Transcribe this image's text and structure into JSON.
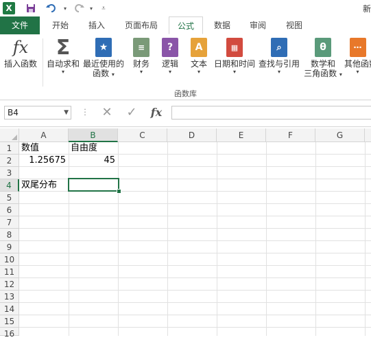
{
  "title_fragment": "新",
  "quick_access": {
    "excel_logo": "X",
    "save_icon": "save-icon",
    "undo_icon": "undo-icon",
    "redo_icon": "redo-icon"
  },
  "tabs": [
    {
      "label": "文件"
    },
    {
      "label": "开始"
    },
    {
      "label": "插入"
    },
    {
      "label": "页面布局"
    },
    {
      "label": "公式"
    },
    {
      "label": "数据"
    },
    {
      "label": "审阅"
    },
    {
      "label": "视图"
    }
  ],
  "active_tab": "公式",
  "ribbon": {
    "insert_function": {
      "label": "插入函数",
      "glyph": "fx"
    },
    "autosum": {
      "label": "自动求和",
      "glyph": "Σ"
    },
    "recent": {
      "line1": "最近使用的",
      "line2": "函数"
    },
    "financial": {
      "label": "财务"
    },
    "logical": {
      "label": "逻辑",
      "glyph": "?"
    },
    "text": {
      "label": "文本",
      "glyph": "A"
    },
    "datetime": {
      "label": "日期和时间"
    },
    "lookup": {
      "label": "查找与引用"
    },
    "math": {
      "line1": "数学和",
      "line2": "三角函数",
      "glyph": "θ"
    },
    "more": {
      "label": "其他函数"
    },
    "group_label": "函数库",
    "colors": {
      "recent": "#2f6db5",
      "financial": "#7a9a78",
      "logical": "#8a55a8",
      "text": "#e6a23a",
      "datetime": "#d24b3f",
      "lookup": "#2f6db5",
      "math": "#5a9a7a",
      "more": "#e8782a"
    }
  },
  "formula_bar": {
    "name_box": "B4",
    "cancel_glyph": "✕",
    "enter_glyph": "✓",
    "fx_glyph": "fx",
    "value": ""
  },
  "columns": [
    "A",
    "B",
    "C",
    "D",
    "E",
    "F",
    "G"
  ],
  "rows": [
    "1",
    "2",
    "3",
    "4",
    "5",
    "6",
    "7",
    "8",
    "9",
    "10",
    "11",
    "12",
    "13",
    "14",
    "15",
    "16"
  ],
  "selected_cell": "B4",
  "cells": {
    "a1": "数值",
    "b1": "自由度",
    "a2": "1.25675",
    "b2": "45",
    "a4": "双尾分布"
  },
  "accent_color": "#217346"
}
